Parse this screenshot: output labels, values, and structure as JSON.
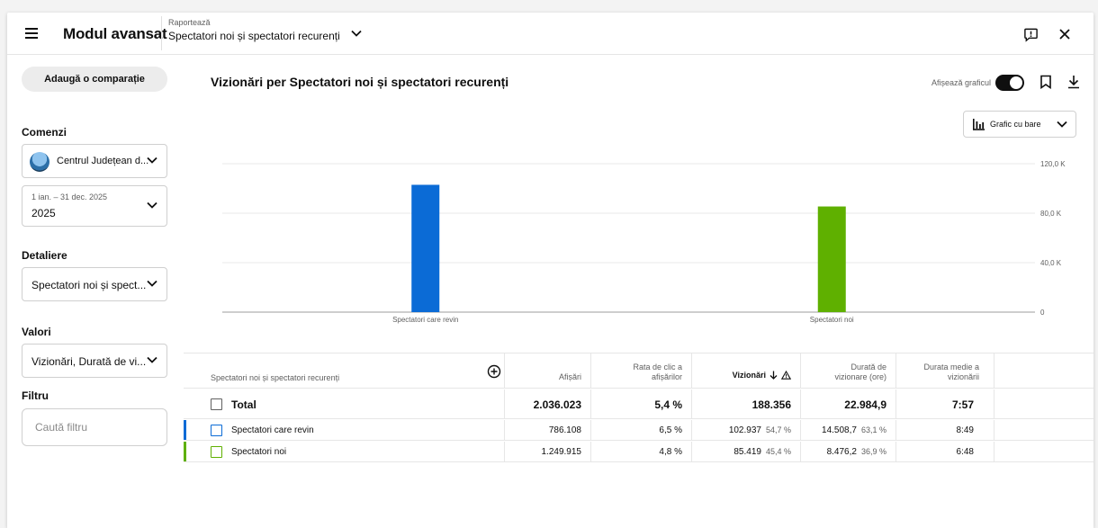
{
  "header": {
    "app_title": "Modul avansat",
    "report_kicker": "Raportează",
    "report_name": "Spectatori noi și spectatori recurenți"
  },
  "sidebar": {
    "compare_button": "Adaugă o comparație",
    "commands_label": "Comenzi",
    "channel_name": "Centrul Județean d...",
    "date_range": "1 ian. – 31 dec. 2025",
    "date_value": "2025",
    "breakdown_label": "Detaliere",
    "breakdown_value": "Spectatori noi și spect...",
    "values_label": "Valori",
    "values_value": "Vizionări, Durată de vi...",
    "filter_label": "Filtru",
    "filter_placeholder": "Caută filtru"
  },
  "main": {
    "chart_title": "Vizionări per Spectatori noi și spectatori recurenți",
    "show_graph_label": "Afișează graficul",
    "show_graph_on": true,
    "chart_type_label": "Grafic cu bare"
  },
  "chart_data": {
    "type": "bar",
    "categories": [
      "Spectatori care revin",
      "Spectatori noi"
    ],
    "values": [
      102937,
      85419
    ],
    "colors": [
      "#0b6bd6",
      "#5fb000"
    ],
    "ylim": [
      0,
      120000
    ],
    "yticks": [
      0,
      40000,
      80000,
      120000
    ],
    "ytick_labels": [
      "0",
      "40,0 K",
      "80,0 K",
      "120,0 K"
    ],
    "grid": true,
    "y_axis_side": "right"
  },
  "table": {
    "headers": {
      "dimension": "Spectatori noi și spectatori recurenți",
      "impressions": "Afișări",
      "ctr": [
        "Rata de clic a",
        "afișărilor"
      ],
      "views": "Vizionări",
      "watch_time": [
        "Durată de",
        "vizionare (ore)"
      ],
      "avg_duration": [
        "Durata medie a",
        "vizionării"
      ]
    },
    "total": {
      "label": "Total",
      "impressions": "2.036.023",
      "ctr": "5,4 %",
      "views": "188.356",
      "watch_time": "22.984,9",
      "avg_duration": "7:57"
    },
    "rows": [
      {
        "label": "Spectatori care revin",
        "impressions": "786.108",
        "ctr": "6,5 %",
        "views": "102.937",
        "views_pct": "54,7 %",
        "watch_time": "14.508,7",
        "watch_time_pct": "63,1 %",
        "avg_duration": "8:49",
        "color": "#0b6bd6"
      },
      {
        "label": "Spectatori noi",
        "impressions": "1.249.915",
        "ctr": "4,8 %",
        "views": "85.419",
        "views_pct": "45,4 %",
        "watch_time": "8.476,2",
        "watch_time_pct": "36,9 %",
        "avg_duration": "6:48",
        "color": "#5fb000"
      }
    ]
  }
}
